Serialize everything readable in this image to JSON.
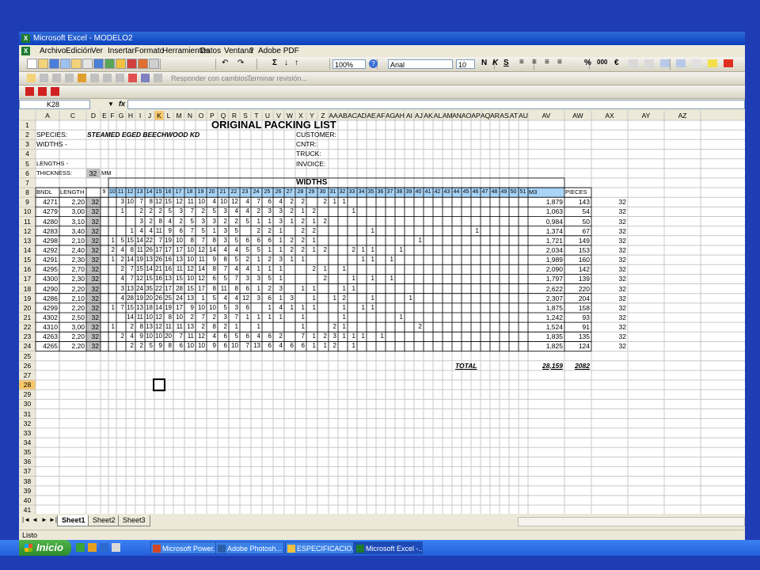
{
  "window": {
    "title": "Microsoft Excel - MODELO2",
    "icon": "excel-icon"
  },
  "menu": [
    "Archivo",
    "Edición",
    "Ver",
    "Insertar",
    "Formato",
    "Herramientas",
    "Datos",
    "Ventana",
    "?",
    "Adobe PDF"
  ],
  "toolbar": {
    "zoom": "100%",
    "font": "Arial",
    "font_size": "10",
    "bold": "N",
    "italic": "K",
    "underline": "S",
    "currency": "€",
    "percent": "%",
    "thousands": "000",
    "review_reply": "Responder con cambios...",
    "review_end": "Terminar revisión..."
  },
  "namebox": "K28",
  "fx_label": "fx",
  "columns": [
    "A",
    "C",
    "D",
    "E",
    "F",
    "G",
    "H",
    "I",
    "J",
    "K",
    "L",
    "M",
    "N",
    "O",
    "P",
    "Q",
    "R",
    "S",
    "T",
    "U",
    "V",
    "W",
    "X",
    "Y",
    "Z",
    "AA",
    "AB",
    "AC",
    "AD",
    "AE",
    "AF",
    "AG",
    "AH",
    "AI",
    "AJ",
    "AK",
    "AL",
    "AM",
    "AN",
    "AO",
    "AP",
    "AQ",
    "AR",
    "AS",
    "AT",
    "AU",
    "AV",
    "AW",
    "AX",
    "AY",
    "AZ"
  ],
  "sheet": {
    "title": "ORIGINAL PACKING LIST",
    "species_label": "SPECIES:",
    "species_value": "STEAMED EGED BEECHWOOD KD",
    "widths_label": "WIDTHS -",
    "lengths_label": "LENGTHS -",
    "thickness_label": "THICKNESS:",
    "thickness_value": "32",
    "thickness_unit": "MM",
    "customer_label": "CUSTOMER:",
    "cntr_label": "CNTR:",
    "truck_label": "TRUCK:",
    "invoice_label": "INVOICE:",
    "widths_header": "WIDTHS",
    "header_bndl": "BNDL",
    "header_length": "LENGTH",
    "header_m3": "M3",
    "header_pieces": "PIECES",
    "width_headers": [
      "9",
      "10",
      "11",
      "12",
      "13",
      "14",
      "15",
      "16",
      "17",
      "18",
      "19",
      "20",
      "21",
      "22",
      "23",
      "24",
      "25",
      "26",
      "27",
      "28",
      "29",
      "30",
      "31",
      "32",
      "33",
      "34",
      "35",
      "36",
      "37",
      "38",
      "39",
      "40",
      "41",
      "42",
      "43",
      "44",
      "45",
      "46",
      "47",
      "48",
      "49",
      "50",
      "51"
    ],
    "total_label": "TOTAL",
    "total_m3": "28,159",
    "total_pieces": "2082",
    "rows": [
      {
        "bndl": "4271",
        "length": "2,20",
        "d": "32",
        "counts": [
          "",
          "",
          "3",
          "10",
          "7",
          "8",
          "12",
          "15",
          "12",
          "11",
          "10",
          "4",
          "10",
          "12",
          "4",
          "7",
          "6",
          "4",
          "2",
          "2",
          "",
          "2",
          "1",
          "1",
          "",
          "",
          "",
          "",
          "",
          "",
          "",
          "",
          "",
          "",
          "",
          "",
          "",
          "",
          "",
          "",
          "",
          "",
          ""
        ],
        "m3": "1,879",
        "pieces": "143",
        "ax": "32"
      },
      {
        "bndl": "4279",
        "length": "3,00",
        "d": "32",
        "counts": [
          "",
          "",
          "1",
          "",
          "2",
          "2",
          "2",
          "5",
          "3",
          "7",
          "2",
          "5",
          "3",
          "4",
          "4",
          "2",
          "3",
          "3",
          "2",
          "1",
          "2",
          "",
          "",
          "",
          "1",
          "",
          "",
          "",
          "",
          "",
          "",
          "",
          "",
          "",
          "",
          "",
          "",
          "",
          "",
          "",
          "",
          "",
          ""
        ],
        "m3": "1,063",
        "pieces": "54",
        "ax": "32"
      },
      {
        "bndl": "4280",
        "length": "3,10",
        "d": "32",
        "counts": [
          "",
          "",
          "",
          "",
          "3",
          "2",
          "8",
          "4",
          "2",
          "5",
          "3",
          "3",
          "2",
          "2",
          "5",
          "1",
          "1",
          "3",
          "1",
          "2",
          "1",
          "2",
          "",
          "",
          "",
          "",
          "",
          "",
          "",
          "",
          "",
          "",
          "",
          "",
          "",
          "",
          "",
          "",
          "",
          "",
          "",
          "",
          ""
        ],
        "m3": "0,984",
        "pieces": "50",
        "ax": "32"
      },
      {
        "bndl": "4283",
        "length": "3,40",
        "d": "32",
        "counts": [
          "",
          "",
          "",
          "1",
          "4",
          "4",
          "11",
          "9",
          "6",
          "7",
          "5",
          "1",
          "3",
          "5",
          "",
          "2",
          "2",
          "1",
          "",
          "2",
          "2",
          "",
          "",
          "",
          "",
          "",
          "1",
          "",
          "",
          "",
          "",
          "",
          "",
          "",
          "",
          "",
          "",
          "1",
          "",
          "",
          "",
          "",
          ""
        ],
        "m3": "1,374",
        "pieces": "67",
        "ax": "32"
      },
      {
        "bndl": "4298",
        "length": "2,10",
        "d": "32",
        "counts": [
          "",
          "1",
          "5",
          "15",
          "14",
          "22",
          "7",
          "19",
          "10",
          "8",
          "7",
          "8",
          "3",
          "5",
          "6",
          "6",
          "6",
          "1",
          "2",
          "2",
          "1",
          "",
          "",
          "",
          "",
          "",
          "",
          "",
          "",
          "",
          "",
          "1",
          "",
          "",
          "",
          "",
          "",
          "",
          "",
          "",
          "",
          "",
          ""
        ],
        "m3": "1,721",
        "pieces": "149",
        "ax": "32"
      },
      {
        "bndl": "4292",
        "length": "2,40",
        "d": "32",
        "counts": [
          "",
          "2",
          "4",
          "8",
          "11",
          "26",
          "17",
          "17",
          "17",
          "10",
          "12",
          "14",
          "4",
          "4",
          "5",
          "5",
          "1",
          "1",
          "2",
          "2",
          "1",
          "2",
          "",
          "",
          "2",
          "1",
          "1",
          "",
          "",
          "1",
          "",
          "",
          "",
          "",
          "",
          "",
          "",
          "",
          "",
          "",
          "",
          "",
          ""
        ],
        "m3": "2,034",
        "pieces": "153",
        "ax": "32"
      },
      {
        "bndl": "4291",
        "length": "2,30",
        "d": "32",
        "counts": [
          "",
          "1",
          "2",
          "14",
          "19",
          "13",
          "26",
          "16",
          "13",
          "10",
          "11",
          "9",
          "8",
          "5",
          "2",
          "1",
          "2",
          "3",
          "1",
          "1",
          "",
          "",
          "",
          "",
          "",
          "1",
          "1",
          "",
          "1",
          "",
          "",
          "",
          "",
          "",
          "",
          "",
          "",
          "",
          "",
          "",
          "",
          "",
          ""
        ],
        "m3": "1,989",
        "pieces": "160",
        "ax": "32"
      },
      {
        "bndl": "4295",
        "length": "2,70",
        "d": "32",
        "counts": [
          "",
          "",
          "2",
          "7",
          "15",
          "14",
          "21",
          "16",
          "11",
          "12",
          "14",
          "8",
          "7",
          "4",
          "4",
          "1",
          "1",
          "1",
          "",
          "",
          "2",
          "1",
          "",
          "1",
          "",
          "",
          "",
          "",
          "",
          "",
          "",
          "",
          "",
          "",
          "",
          "",
          "",
          "",
          "",
          "",
          "",
          "",
          ""
        ],
        "m3": "2,090",
        "pieces": "142",
        "ax": "32"
      },
      {
        "bndl": "4300",
        "length": "2,30",
        "d": "32",
        "counts": [
          "",
          "",
          "4",
          "7",
          "12",
          "15",
          "16",
          "13",
          "15",
          "10",
          "12",
          "6",
          "5",
          "7",
          "3",
          "3",
          "5",
          "1",
          "",
          "",
          "",
          "2",
          "",
          "",
          "1",
          "",
          "1",
          "",
          "1",
          "",
          "",
          "",
          "",
          "",
          "",
          "",
          "",
          "",
          "",
          "",
          "",
          "",
          ""
        ],
        "m3": "1,797",
        "pieces": "139",
        "ax": "32"
      },
      {
        "bndl": "4290",
        "length": "2,20",
        "d": "32",
        "counts": [
          "",
          "",
          "3",
          "13",
          "24",
          "35",
          "22",
          "17",
          "28",
          "15",
          "17",
          "8",
          "11",
          "8",
          "6",
          "1",
          "2",
          "3",
          "",
          "1",
          "1",
          "",
          "",
          "1",
          "1",
          "",
          "",
          "",
          "",
          "",
          "",
          "",
          "",
          "",
          "",
          "",
          "",
          "",
          "",
          "",
          "",
          "",
          ""
        ],
        "m3": "2,622",
        "pieces": "220",
        "ax": "32"
      },
      {
        "bndl": "4286",
        "length": "2,10",
        "d": "32",
        "counts": [
          "",
          "",
          "4",
          "28",
          "19",
          "20",
          "26",
          "25",
          "24",
          "13",
          "1",
          "5",
          "4",
          "4",
          "12",
          "3",
          "6",
          "1",
          "3",
          "",
          "1",
          "",
          "1",
          "2",
          "",
          "",
          "1",
          "",
          "",
          "",
          "1",
          "",
          "",
          "",
          "",
          "",
          "",
          "",
          "",
          "",
          "",
          "",
          ""
        ],
        "m3": "2,307",
        "pieces": "204",
        "ax": "32"
      },
      {
        "bndl": "4299",
        "length": "2,20",
        "d": "32",
        "counts": [
          "",
          "1",
          "7",
          "15",
          "13",
          "18",
          "14",
          "19",
          "17",
          "9",
          "10",
          "10",
          "5",
          "3",
          "6",
          "",
          "1",
          "4",
          "1",
          "1",
          "1",
          "",
          "",
          "1",
          "",
          "1",
          "1",
          "",
          "",
          "",
          "",
          "",
          "",
          "",
          "",
          "",
          "",
          "",
          "",
          "",
          "",
          "",
          ""
        ],
        "m3": "1,875",
        "pieces": "158",
        "ax": "32"
      },
      {
        "bndl": "4302",
        "length": "2,50",
        "d": "32",
        "counts": [
          "",
          "",
          "",
          "14",
          "11",
          "10",
          "12",
          "8",
          "10",
          "2",
          "7",
          "2",
          "3",
          "7",
          "1",
          "1",
          "1",
          "1",
          "",
          "1",
          "",
          "",
          "",
          "1",
          "",
          "",
          "",
          "",
          "",
          "1",
          "",
          "",
          "",
          "",
          "",
          "",
          "",
          "",
          "",
          "",
          "",
          "",
          ""
        ],
        "m3": "1,242",
        "pieces": "93",
        "ax": "32"
      },
      {
        "bndl": "4310",
        "length": "3,00",
        "d": "32",
        "counts": [
          "",
          "1",
          "",
          "2",
          "8",
          "13",
          "12",
          "11",
          "11",
          "13",
          "2",
          "8",
          "2",
          "1",
          "",
          "1",
          "",
          "",
          "",
          "1",
          "",
          "",
          "2",
          "1",
          "",
          "",
          "",
          "",
          "",
          "",
          "",
          "2",
          "",
          "",
          "",
          "",
          "",
          "",
          "",
          "",
          "",
          "",
          ""
        ],
        "m3": "1,524",
        "pieces": "91",
        "ax": "32"
      },
      {
        "bndl": "4263",
        "length": "2,20",
        "d": "32",
        "counts": [
          "",
          "",
          "2",
          "4",
          "9",
          "10",
          "10",
          "20",
          "7",
          "11",
          "12",
          "4",
          "6",
          "5",
          "6",
          "4",
          "6",
          "2",
          "",
          "7",
          "1",
          "2",
          "3",
          "1",
          "1",
          "1",
          "",
          "1",
          "",
          "",
          "",
          "",
          "",
          "",
          "",
          "",
          "",
          "",
          "",
          "",
          "",
          "",
          ""
        ],
        "m3": "1,835",
        "pieces": "135",
        "ax": "32"
      },
      {
        "bndl": "4265",
        "length": "2,20",
        "d": "32",
        "counts": [
          "",
          "",
          "",
          "2",
          "2",
          "5",
          "9",
          "8",
          "6",
          "10",
          "10",
          "9",
          "6",
          "10",
          "7",
          "13",
          "6",
          "4",
          "6",
          "6",
          "1",
          "1",
          "2",
          "",
          "1",
          "",
          "",
          "",
          "",
          "",
          "",
          "",
          "",
          "",
          "",
          "",
          "",
          "",
          "",
          "",
          "",
          "",
          ""
        ],
        "m3": "1,825",
        "pieces": "124",
        "ax": "32"
      }
    ]
  },
  "sheet_tabs": [
    "Sheet1",
    "Sheet2",
    "Sheet3"
  ],
  "status": "Listo",
  "taskbar": {
    "start": "Inicio",
    "tasks": [
      "Microsoft Power...",
      "Adobe Photosh...",
      "ESPECIFICACIO...",
      "Microsoft Excel -..."
    ]
  }
}
